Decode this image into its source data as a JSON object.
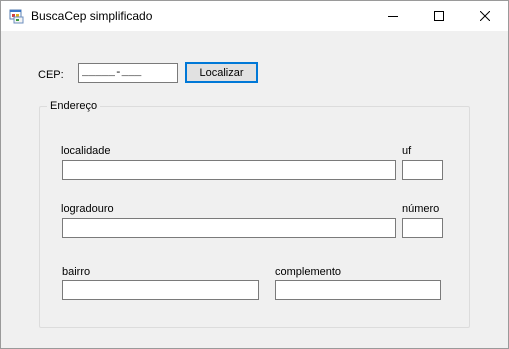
{
  "window": {
    "title": "BuscaCep simplificado",
    "icon": "app-window-icon",
    "controls": {
      "minimize": "minimize-icon",
      "maximize": "maximize-icon",
      "close": "close-icon"
    }
  },
  "search": {
    "cep_label": "CEP:",
    "cep_value": "_____-___",
    "button_label": "Localizar"
  },
  "address_group": {
    "title": "Endereço",
    "fields": {
      "localidade": {
        "label": "localidade",
        "value": ""
      },
      "uf": {
        "label": "uf",
        "value": ""
      },
      "logradouro": {
        "label": "logradouro",
        "value": ""
      },
      "numero": {
        "label": "número",
        "value": ""
      },
      "bairro": {
        "label": "bairro",
        "value": ""
      },
      "complemento": {
        "label": "complemento",
        "value": ""
      }
    }
  },
  "colors": {
    "window_bg": "#f0f0f0",
    "titlebar_bg": "#ffffff",
    "accent": "#0078d7"
  }
}
